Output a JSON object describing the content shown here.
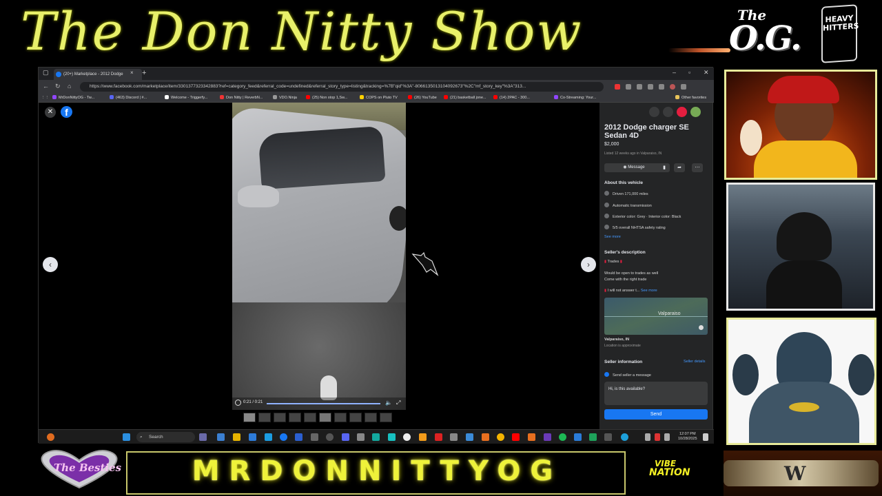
{
  "stream": {
    "title": "The Don Nitty Show",
    "og_logo_the": "The",
    "og_logo_main": "O.G.",
    "heavy_logo": "HEAVY HITTERS",
    "name_bar": "MRDONNITTYOG",
    "hearts_logo": "The Besties",
    "vibe_logo_top": "VIBE",
    "vibe_logo_bottom": "NATION"
  },
  "browser": {
    "tab_title": "(20+) Marketplace - 2012 Dodge",
    "tab_close": "×",
    "new_tab": "+",
    "url": "https://www.facebook.com/marketplace/item/3301377323342883?ref=category_feed&referral_code=undefined&referral_story_type=listing&tracking=%7B\"qid\"%3A\"-8066135013104092673\"%2C\"mf_story_key\"%3A\"313...",
    "bookmarks": [
      {
        "label": "MrDonNittyOG - Tw...",
        "color": "#9146ff"
      },
      {
        "label": "(463) Discord | #...",
        "color": "#5865f2"
      },
      {
        "label": "Welcome - Triggerfy...",
        "color": "#ffffff"
      },
      {
        "label": "Don Nitty | ReverbN...",
        "color": "#e33"
      },
      {
        "label": "VDO.Ninja",
        "color": "#999"
      },
      {
        "label": "(25) Non stop 1,Sw...",
        "color": "#f00"
      },
      {
        "label": "COPS on Pluto TV",
        "color": "#ffd100"
      },
      {
        "label": "(26) YouTube",
        "color": "#f00"
      },
      {
        "label": "(21) basketball jone...",
        "color": "#f00"
      },
      {
        "label": "(14) 2PAC - 300...",
        "color": "#f00"
      },
      {
        "label": "Co-Streaming: Your...",
        "color": "#9146ff"
      },
      {
        "label": "Other favorites",
        "color": "#e8c45a"
      }
    ]
  },
  "listing": {
    "title": "2012 Dodge charger SE Sedan 4D",
    "price": "$2,000",
    "meta": "Listed 12 weeks ago in Valparaiso, IN",
    "message_button": "Message",
    "about_heading": "About this vehicle",
    "details": [
      "Driven 171,000 miles",
      "Automatic transmission",
      "Exterior color: Grey · Interior color: Black",
      "5/5 overall NHTSA safety rating"
    ],
    "see_more": "See more",
    "seller_desc_heading": "Seller's description",
    "desc_trades": "Trades",
    "desc_line1": "Would be open to trades as well",
    "desc_line2": "Come with the right trade",
    "desc_line3": "I will not answer t...",
    "desc_see_more": "See more",
    "map_label": "Valparaiso",
    "location": "Valparaiso, IN",
    "location_note": "Location is approximate",
    "seller_info_heading": "Seller information",
    "seller_details_link": "Seller details",
    "send_message_label": "Send seller a message",
    "message_text": "Hi, is this available?",
    "send_button": "Send"
  },
  "video": {
    "time": "0:21 / 0:21"
  },
  "taskbar": {
    "search_label": "Search",
    "time": "12:07 PM",
    "date": "10/28/2025"
  },
  "colors": {
    "banner_text": "#e8f06a",
    "facebook_blue": "#1877f2",
    "name_bar_text": "#eef23a"
  }
}
